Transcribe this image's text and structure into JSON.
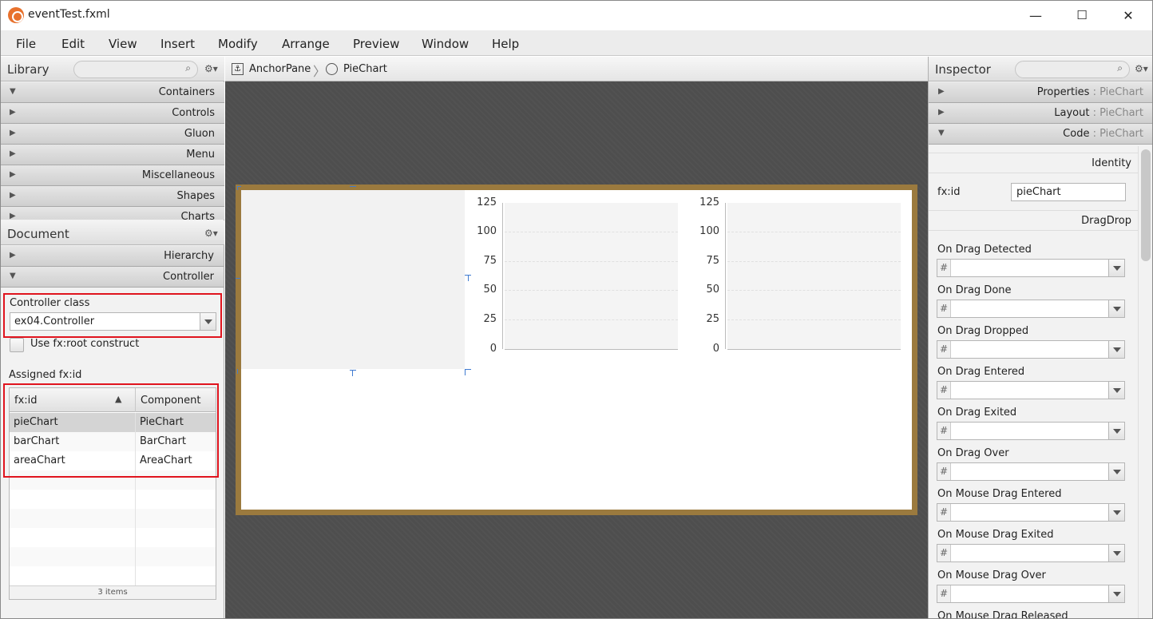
{
  "window": {
    "title": "eventTest.fxml",
    "minimize": "—",
    "maximize": "☐",
    "close": "✕"
  },
  "menu": [
    "File",
    "Edit",
    "View",
    "Insert",
    "Modify",
    "Arrange",
    "Preview",
    "Window",
    "Help"
  ],
  "library": {
    "title": "Library",
    "sections": [
      "Containers",
      "Controls",
      "Gluon",
      "Menu",
      "Miscellaneous",
      "Shapes",
      "Charts"
    ]
  },
  "document": {
    "title": "Document",
    "sections": [
      {
        "label": "Hierarchy",
        "expanded": false
      },
      {
        "label": "Controller",
        "expanded": true
      }
    ],
    "controller_class_label": "Controller class",
    "controller_class_value": "ex04.Controller",
    "use_root_label": "Use fx:root construct",
    "assigned_label": "Assigned fx:id",
    "table": {
      "columns": [
        "fx:id",
        "Component"
      ],
      "rows": [
        {
          "fxid": "pieChart",
          "component": "PieChart"
        },
        {
          "fxid": "barChart",
          "component": "BarChart"
        },
        {
          "fxid": "areaChart",
          "component": "AreaChart"
        }
      ],
      "footer": "3 items"
    }
  },
  "breadcrumb": {
    "items": [
      "AnchorPane",
      "PieChart"
    ]
  },
  "charts": {
    "y_ticks": [
      "125",
      "100",
      "75",
      "50",
      "25",
      "0"
    ]
  },
  "inspector": {
    "title": "Inspector",
    "sections": [
      {
        "label": "Properties",
        "sub": " : PieChart",
        "expanded": false
      },
      {
        "label": "Layout",
        "sub": " : PieChart",
        "expanded": false
      },
      {
        "label": "Code",
        "sub": " : PieChart",
        "expanded": true
      }
    ],
    "identity_header": "Identity",
    "fxid_label": "fx:id",
    "fxid_value": "pieChart",
    "dragdrop_header": "DragDrop",
    "events": [
      "On Drag Detected",
      "On Drag Done",
      "On Drag Dropped",
      "On Drag Entered",
      "On Drag Exited",
      "On Drag Over",
      "On Mouse Drag Entered",
      "On Mouse Drag Exited",
      "On Mouse Drag Over",
      "On Mouse Drag Released"
    ],
    "hash": "#"
  },
  "colors": {
    "frame": "#9b7a3e",
    "highlight": "#e0141e",
    "canvas": "#4e4e4e"
  }
}
